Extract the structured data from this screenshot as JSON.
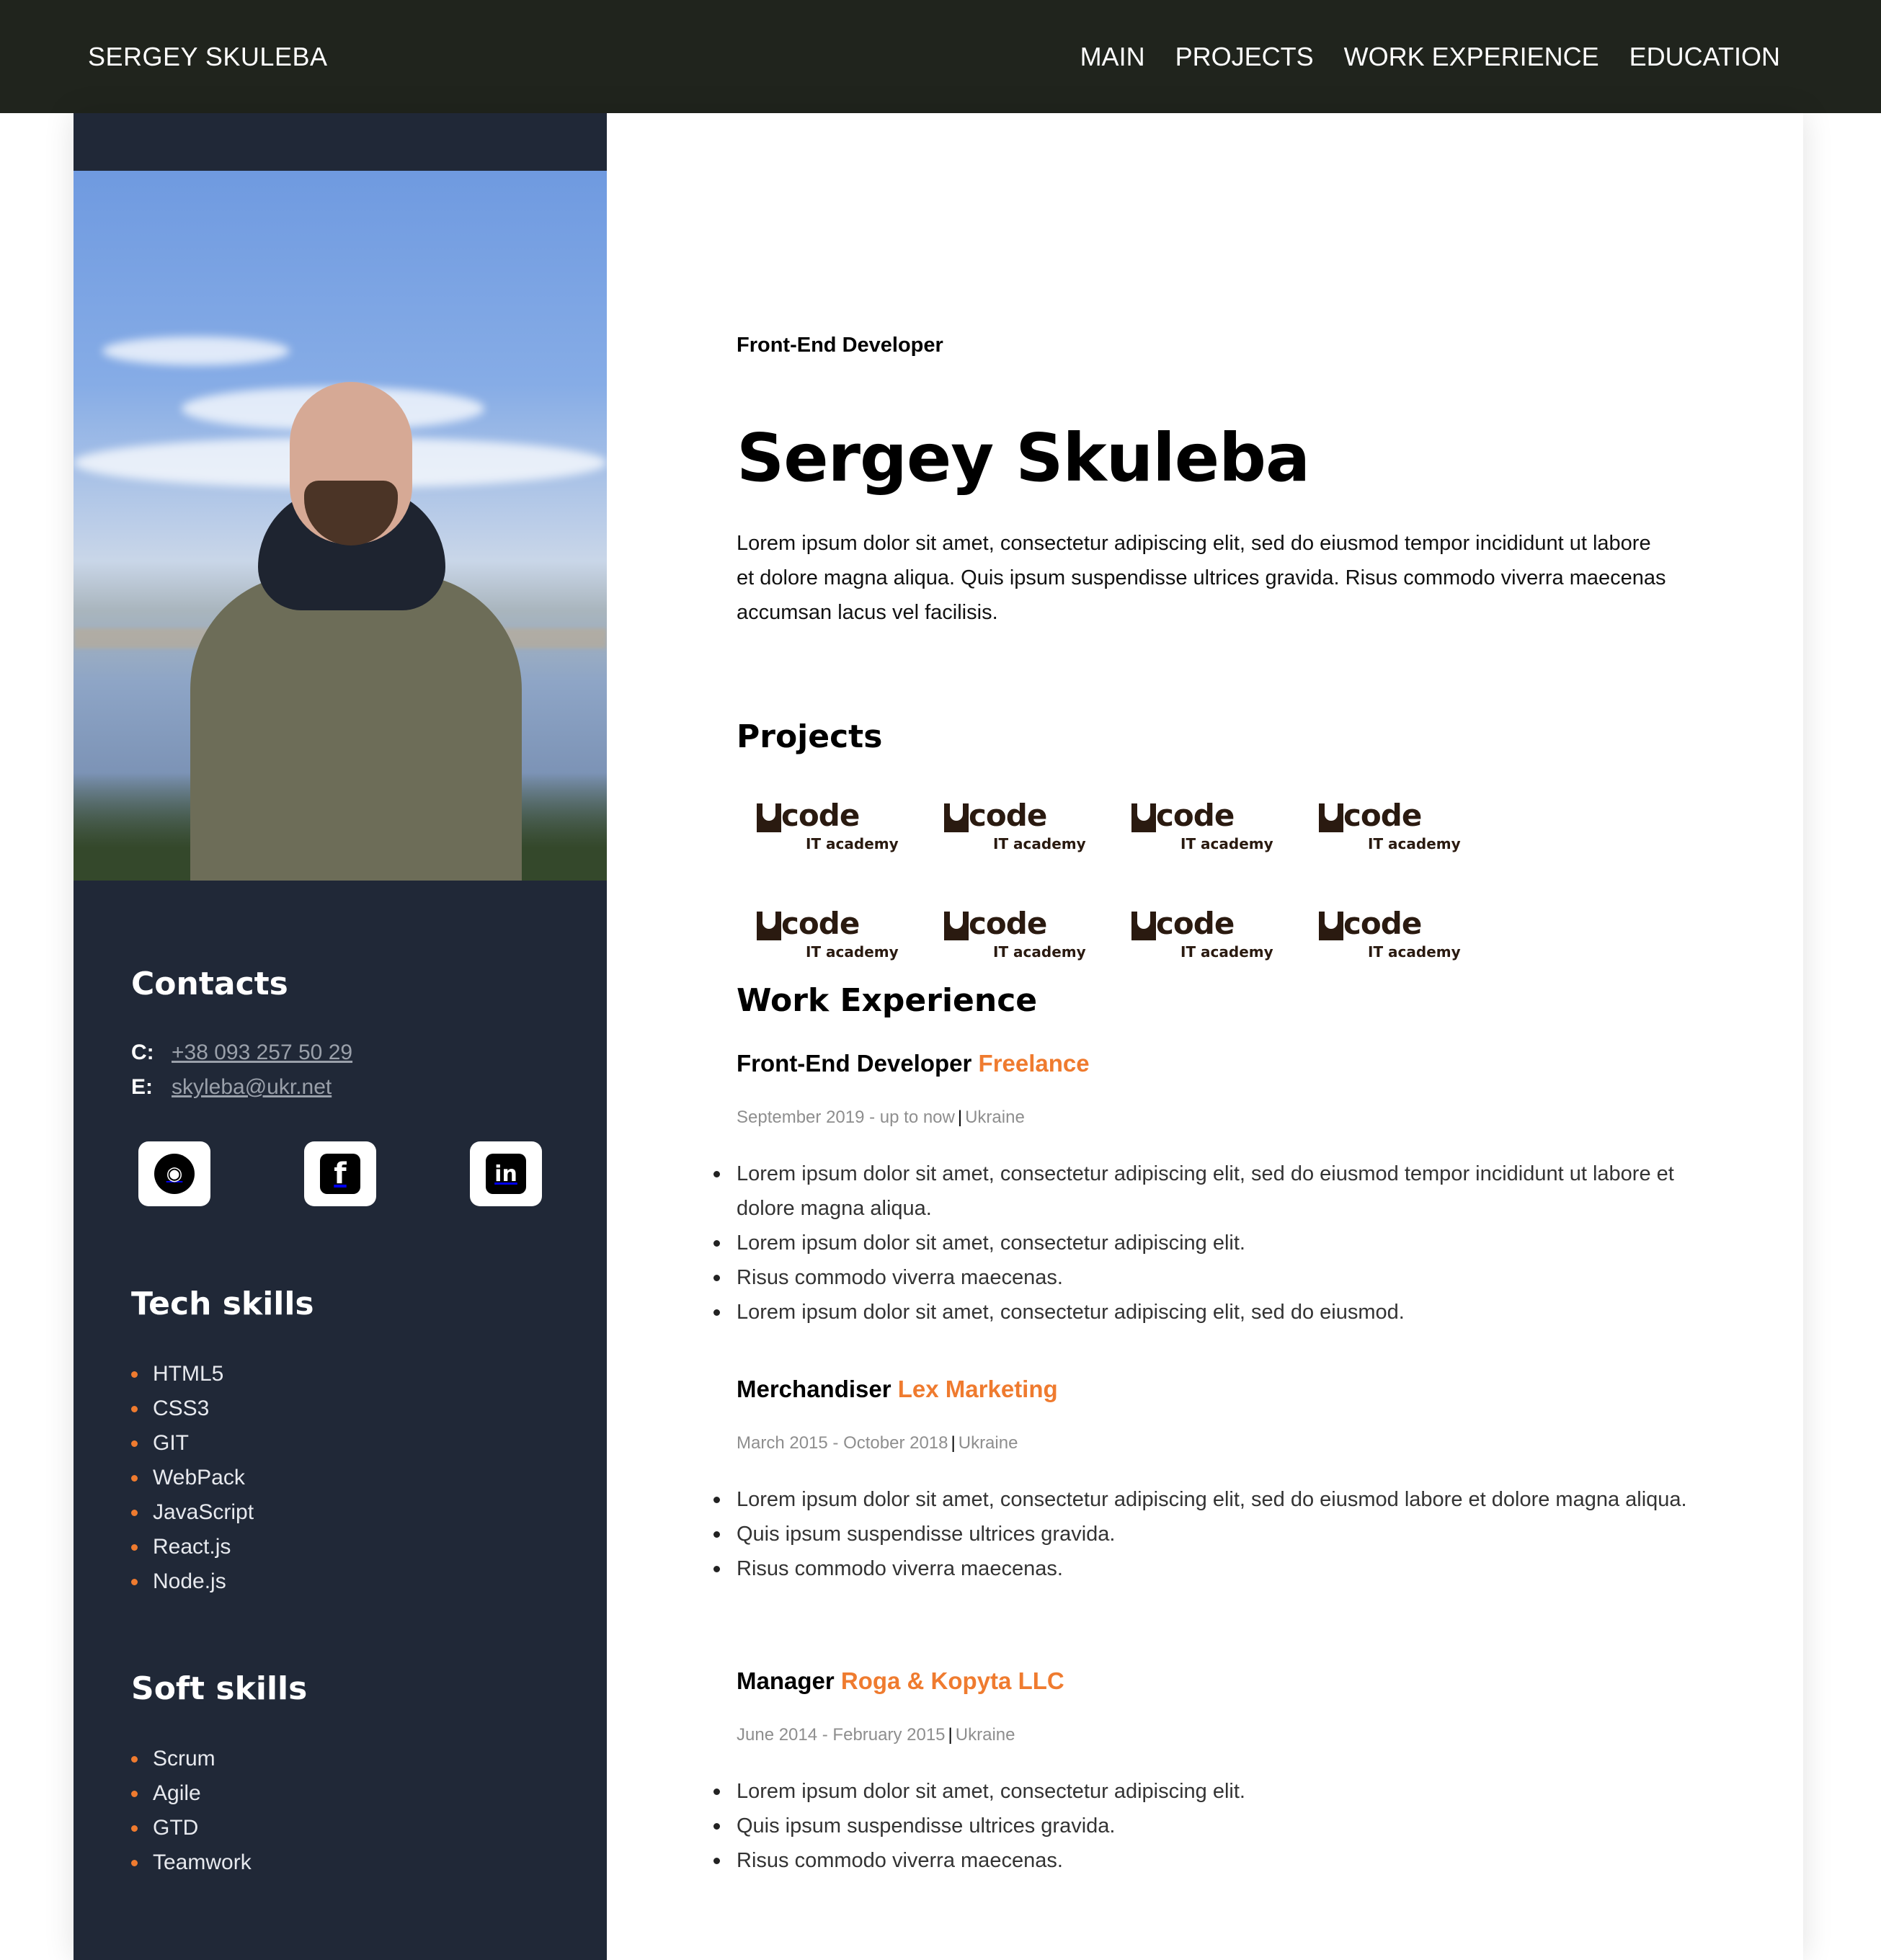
{
  "header": {
    "brand": "SERGEY SKULEBA",
    "nav": [
      "MAIN",
      "PROJECTS",
      "WORK EXPERIENCE",
      "EDUCATION"
    ]
  },
  "sidebar": {
    "contacts_title": "Contacts",
    "contacts": [
      {
        "key": "C:",
        "value": "+38 093 257 50 29"
      },
      {
        "key": "E:",
        "value": "skyleba@ukr.net"
      }
    ],
    "social": [
      {
        "name": "github-icon",
        "glyph": "◉"
      },
      {
        "name": "facebook-icon",
        "glyph": "f"
      },
      {
        "name": "linkedin-icon",
        "glyph": "in"
      }
    ],
    "tech_title": "Tech skills",
    "tech_skills": [
      "HTML5",
      "CSS3",
      "GIT",
      "WebPack",
      "JavaScript",
      "React.js",
      "Node.js"
    ],
    "soft_title": "Soft skills",
    "soft_skills": [
      "Scrum",
      "Agile",
      "GTD",
      "Teamwork"
    ]
  },
  "main": {
    "role": "Front-End Developer",
    "name": "Sergey Skuleba",
    "intro": "Lorem ipsum dolor sit amet, consectetur adipiscing elit, sed do eiusmod tempor incididunt ut labore et dolore magna aliqua. Quis ipsum suspendisse ultrices gravida. Risus commodo viverra maecenas accumsan lacus vel facilisis.",
    "projects_title": "Projects",
    "projects": [
      {
        "word": "code",
        "sub": "IT academy"
      },
      {
        "word": "code",
        "sub": "IT academy"
      },
      {
        "word": "code",
        "sub": "IT academy"
      },
      {
        "word": "code",
        "sub": "IT academy"
      },
      {
        "word": "code",
        "sub": "IT academy"
      },
      {
        "word": "code",
        "sub": "IT academy"
      },
      {
        "word": "code",
        "sub": "IT academy"
      },
      {
        "word": "code",
        "sub": "IT academy"
      }
    ],
    "work_title": "Work Experience",
    "jobs": [
      {
        "position": "Front-End Developer",
        "company": "Freelance",
        "period": "September 2019 - up to now",
        "location": "Ukraine",
        "bullets": [
          "Lorem ipsum dolor sit amet, consectetur adipiscing elit, sed do eiusmod tempor incididunt ut labore et dolore magna aliqua.",
          "Lorem ipsum dolor sit amet, consectetur adipiscing elit.",
          "Risus commodo viverra maecenas.",
          "Lorem ipsum dolor sit amet, consectetur adipiscing elit, sed do eiusmod."
        ]
      },
      {
        "position": "Merchandiser",
        "company": "Lex Marketing",
        "period": "March 2015 - October 2018",
        "location": "Ukraine",
        "bullets": [
          "Lorem ipsum dolor sit amet, consectetur adipiscing elit, sed do eiusmod labore et dolore magna aliqua.",
          "Quis ipsum suspendisse ultrices gravida.",
          "Risus commodo viverra maecenas."
        ]
      },
      {
        "position": "Manager",
        "company": "Roga & Kopyta LLC",
        "period": "June 2014 - February 2015",
        "location": "Ukraine",
        "bullets": [
          "Lorem ipsum dolor sit amet, consectetur adipiscing elit.",
          "Quis ipsum suspendisse ultrices gravida.",
          "Risus commodo viverra maecenas."
        ]
      }
    ]
  },
  "colors": {
    "topbar": "#20241d",
    "sidebar": "#202837",
    "accent": "#ef7b2f"
  }
}
